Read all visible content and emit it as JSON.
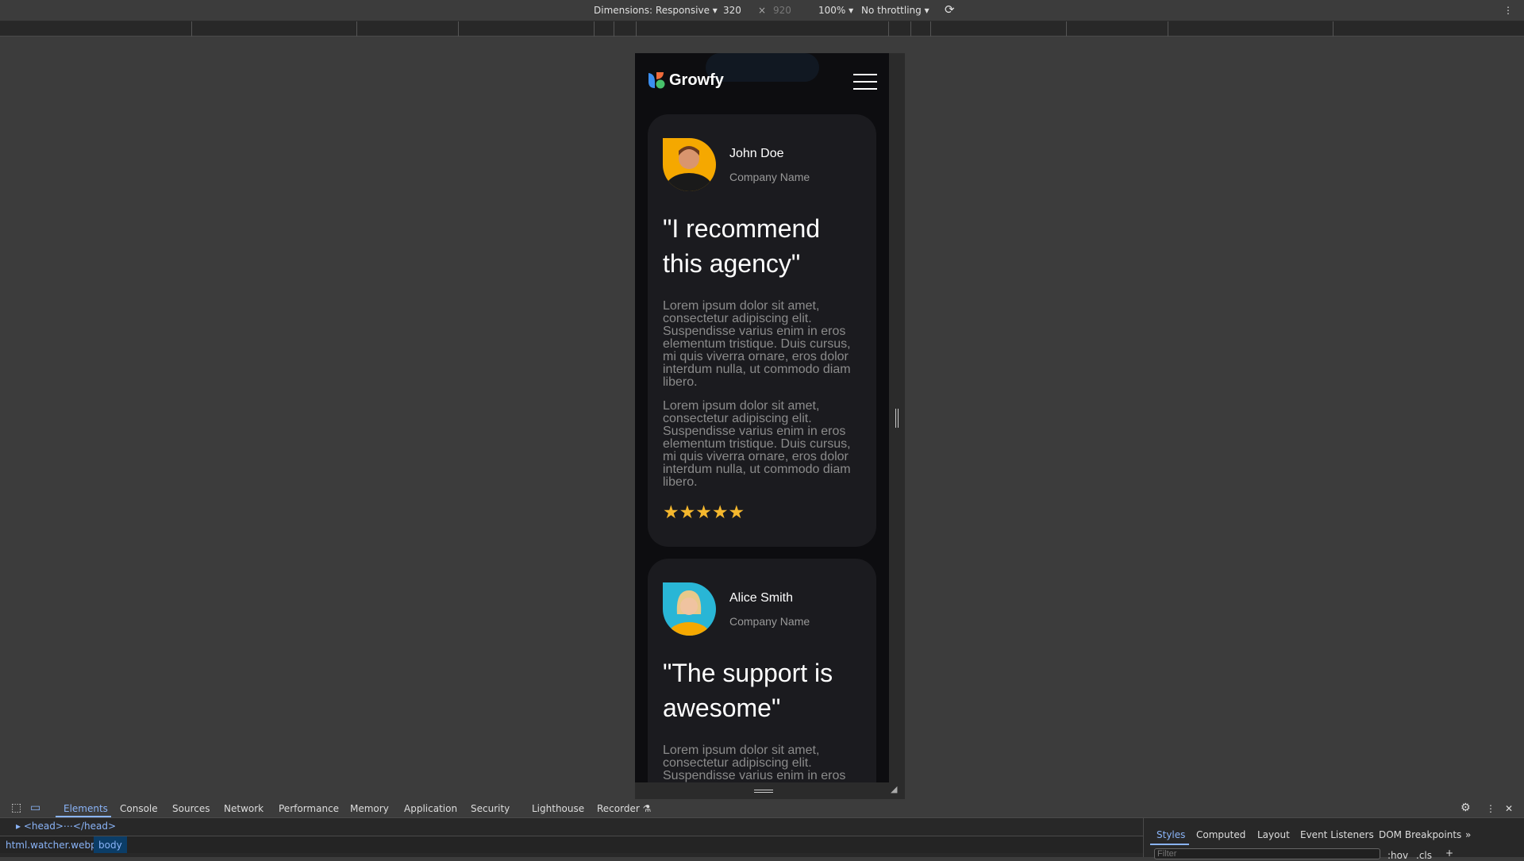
{
  "toolbar": {
    "dimensions": "Dimensions: Responsive ▾",
    "width": "320",
    "times": "×",
    "height": "920",
    "zoom": "100% ▾",
    "throttle": "No throttling ▾",
    "rotate_icon": "rotate-icon",
    "more": "⋮"
  },
  "site": {
    "brand": "Growfy",
    "menu_icon": "hamburger-icon",
    "testimonials": [
      {
        "name": "John Doe",
        "company": "Company Name",
        "quote": "\"I recommend this agency\"",
        "paragraphs": [
          "Lorem ipsum dolor sit amet, consectetur adipiscing elit. Suspendisse varius enim in eros elementum tristique. Duis cursus, mi quis viverra ornare, eros dolor interdum nulla, ut commodo diam libero.",
          "Lorem ipsum dolor sit amet, consectetur adipiscing elit. Suspendisse varius enim in eros elementum tristique. Duis cursus, mi quis viverra ornare, eros dolor interdum nulla, ut commodo diam libero."
        ],
        "rating": 5,
        "stars": "★★★★★",
        "avatar_color": "#f5a800"
      },
      {
        "name": "Alice Smith",
        "company": "Company Name",
        "quote": "\"The support is awesome\"",
        "paragraphs": [
          "Lorem ipsum dolor sit amet, consectetur adipiscing elit. Suspendisse varius enim in eros elementum tristique. Duis cursus, mi quis viverra ornare, eros dolor interdum nulla, ut commodo diam libero."
        ],
        "avatar_color": "#29b6d6"
      }
    ]
  },
  "devtools": {
    "tabs": [
      "Elements",
      "Console",
      "Sources",
      "Network",
      "Performance",
      "Memory",
      "Application",
      "Security",
      "Lighthouse",
      "Recorder ⚗"
    ],
    "element_row": "▸ <head>⋯</head>",
    "breadcrumbs": [
      "html.watcher.webp",
      "body"
    ],
    "side_tabs": [
      "Styles",
      "Computed",
      "Layout",
      "Event Listeners",
      "DOM Breakpoints",
      "»"
    ],
    "filter_placeholder": "Filter",
    "hov": ":hov",
    ".cls": ".cls",
    "accent": "#8ab4f8"
  }
}
